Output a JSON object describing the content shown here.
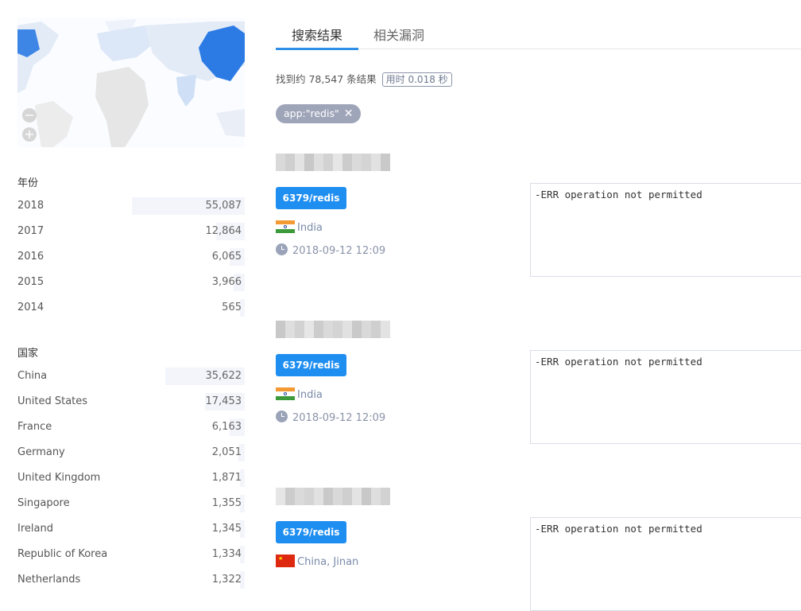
{
  "map": {
    "zoom_out": "−",
    "zoom_in": "+"
  },
  "facets": {
    "year": {
      "title": "年份",
      "items": [
        {
          "label": "2018",
          "count": "55,087",
          "share": 0.51
        },
        {
          "label": "2017",
          "count": "12,864",
          "share": 0.13
        },
        {
          "label": "2016",
          "count": "6,065",
          "share": 0.07
        },
        {
          "label": "2015",
          "count": "3,966",
          "share": 0.05
        },
        {
          "label": "2014",
          "count": "565",
          "share": 0.02
        }
      ]
    },
    "country": {
      "title": "国家",
      "items": [
        {
          "label": "China",
          "count": "35,622",
          "share": 0.36
        },
        {
          "label": "United States",
          "count": "17,453",
          "share": 0.18
        },
        {
          "label": "France",
          "count": "6,163",
          "share": 0.07
        },
        {
          "label": "Germany",
          "count": "2,051",
          "share": 0.03
        },
        {
          "label": "United Kingdom",
          "count": "1,871",
          "share": 0.02
        },
        {
          "label": "Singapore",
          "count": "1,355",
          "share": 0.02
        },
        {
          "label": "Ireland",
          "count": "1,345",
          "share": 0.02
        },
        {
          "label": "Republic of Korea",
          "count": "1,334",
          "share": 0.02
        },
        {
          "label": "Netherlands",
          "count": "1,322",
          "share": 0.02
        }
      ]
    }
  },
  "tabs": {
    "search_results": "搜索结果",
    "related_vulns": "相关漏洞"
  },
  "summary": {
    "text": "找到约 78,547 条结果",
    "time": "用时 0.018 秒"
  },
  "filter_chip": {
    "label": "app:\"redis\"",
    "remove": "✕"
  },
  "results": [
    {
      "port": "6379/redis",
      "location": "India",
      "flag": "india",
      "time": "2018-09-12 12:09",
      "banner": "-ERR operation not permitted"
    },
    {
      "port": "6379/redis",
      "location": "India",
      "flag": "india",
      "time": "2018-09-12 12:09",
      "banner": "-ERR operation not permitted"
    },
    {
      "port": "6379/redis",
      "location": "China, Jinan",
      "flag": "china",
      "time": "",
      "banner": "-ERR operation not permitted"
    }
  ],
  "colors": {
    "accent": "#2f8fe8",
    "port_tag": "#1f8ef1",
    "chip": "#9fa5b9",
    "map_highlight": "#2c7be5"
  }
}
